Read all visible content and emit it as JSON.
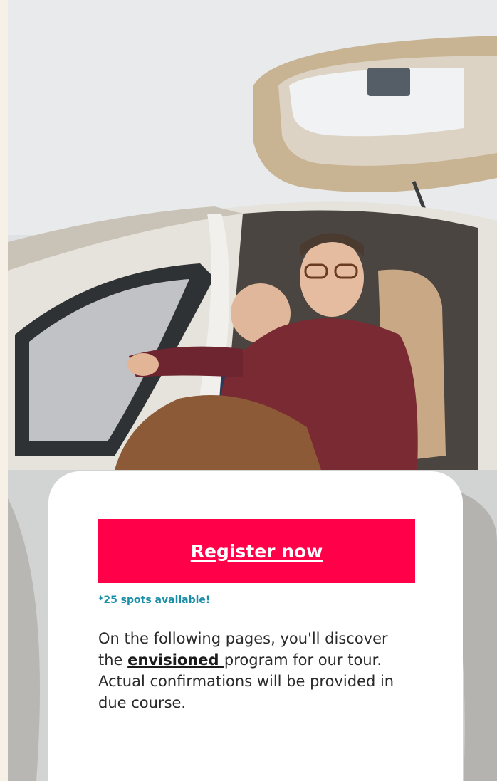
{
  "hero": {
    "image_subject": "two-men-in-aircraft-cockpit"
  },
  "card": {
    "cta_label": "Register now",
    "spots_text": "*25 spots available!",
    "desc_before": "On the following pages, you'll discover the ",
    "desc_link": "envisioned ",
    "desc_after": "program for our tour. Actual confirmations will be provided in due course."
  },
  "colors": {
    "cta_background": "#ff0049",
    "spots_text": "#1a8fa8",
    "card_background": "#ffffff"
  }
}
